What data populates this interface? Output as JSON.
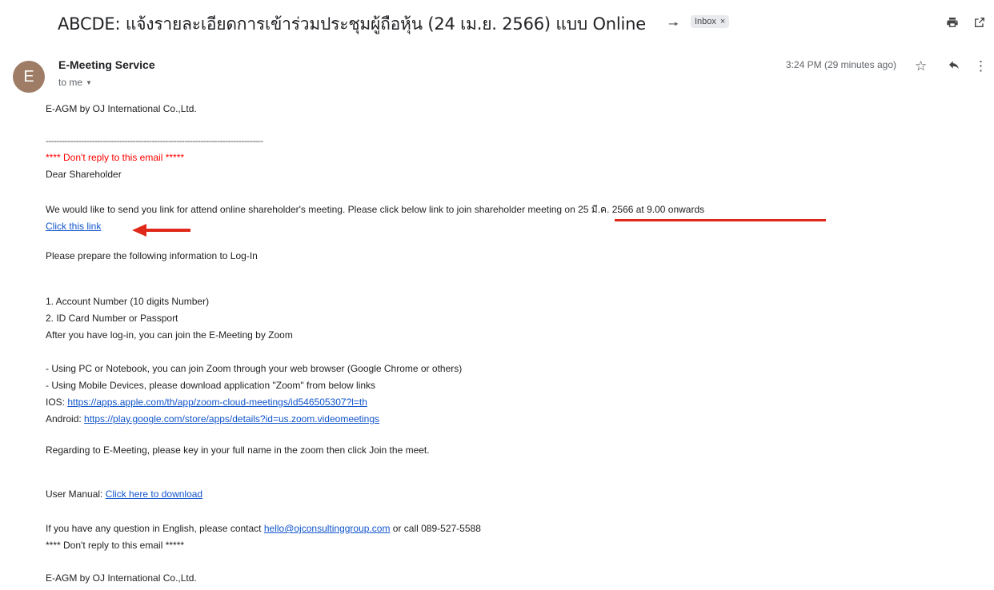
{
  "subject": "ABCDE: แจ้งรายละเอียดการเข้าร่วมประชุมผู้ถือหุ้น (24 เม.ย. 2566) แบบ Online",
  "label": "Inbox",
  "sender": {
    "initial": "E",
    "name": "E-Meeting Service",
    "to": "to me",
    "time": "3:24 PM (29 minutes ago)"
  },
  "icons": {
    "important": "important-marker-icon",
    "print": "print-icon",
    "open_new": "open-in-new-window-icon",
    "star": "star-icon",
    "reply": "reply-icon",
    "more": "more-vert-icon",
    "label_close": "close-icon",
    "caret": "caret-down-icon",
    "annotation_arrow": "red-arrow-left"
  },
  "colors": {
    "warning": "#ff0000",
    "link": "#1155cc",
    "annotation": "#e0291a",
    "avatar": "#9e7c65"
  },
  "email": {
    "company_top": "E-AGM by OJ International Co.,Ltd.",
    "separator": "--------------------------------------------------------------------------------",
    "warning_top": "**** Don't reply to this email *****",
    "greeting": "Dear Shareholder",
    "intro": "We would like to send you link for attend online shareholder's meeting. Please click below link to join shareholder meeting on 25 มี.ค. 2566 at 9.00 onwards",
    "click_link": "Click this link",
    "prepare": "Please prepare the following information to Log-In",
    "item1": "1. Account Number (10 digits Number)",
    "item2": "2. ID Card Number or Passport",
    "after_login": "After you have log-in, you can join the E-Meeting by Zoom",
    "pc_line": "- Using PC or Notebook, you can join Zoom through your web browser (Google Chrome or others)",
    "mobile_line": "- Using Mobile Devices, please download application \"Zoom\" from below links",
    "ios_label": "IOS: ",
    "ios_url": "https://apps.apple.com/th/app/zoom-cloud-meetings/id546505307?l=th",
    "android_label": "Android: ",
    "android_url": "https://play.google.com/store/apps/details?id=us.zoom.videomeetings",
    "regarding": "Regarding to E-Meeting, please key in your full name in the zoom then click Join the meet.",
    "manual_label": "User Manual: ",
    "manual_link": "Click here to download",
    "question_pre": "If you have any question in English, please contact ",
    "question_email": "hello@ojconsultinggroup.com",
    "question_post": " or call 089-527-5588",
    "warning_bottom": "**** Don't reply to this email *****",
    "company_bottom": "E-AGM by OJ International Co.,Ltd."
  }
}
